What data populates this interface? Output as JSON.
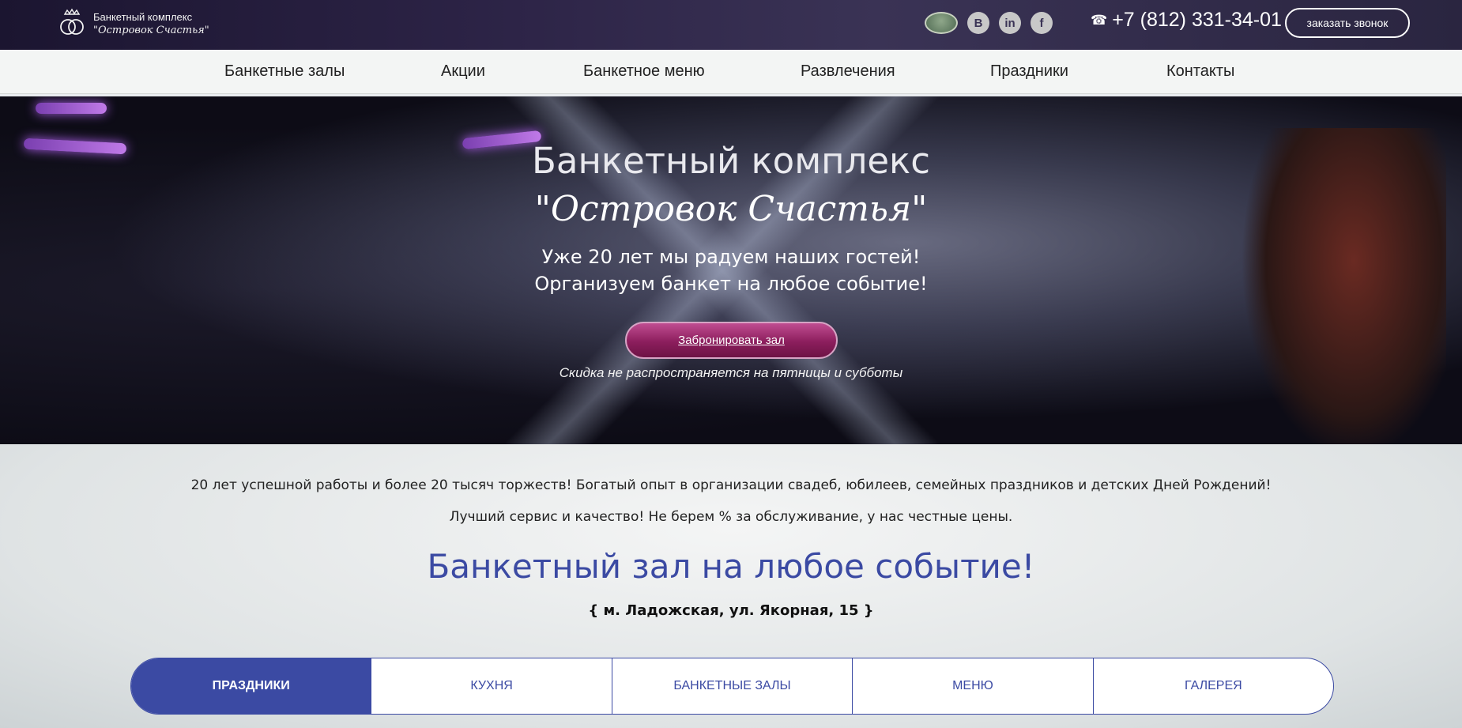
{
  "logo": {
    "line1": "Банкетный комплекс",
    "line2": "\"Островок Счастья\""
  },
  "header": {
    "socials": [
      {
        "icon": "vk-icon",
        "glyph": "B"
      },
      {
        "icon": "linkedin-icon",
        "glyph": "in"
      },
      {
        "icon": "facebook-icon",
        "glyph": "f"
      }
    ],
    "phone": "+7 (812) 331-34-01",
    "callback_label": "заказать звонок"
  },
  "nav": {
    "items": [
      {
        "label": "Банкетные залы"
      },
      {
        "label": "Акции"
      },
      {
        "label": "Банкетное меню"
      },
      {
        "label": "Развлечения"
      },
      {
        "label": "Праздники"
      },
      {
        "label": "Контакты"
      }
    ]
  },
  "hero": {
    "title": "Банкетный комплекс",
    "script_title": "\"Островок Счастья\"",
    "subtitle_line1": "Уже 20 лет мы радуем наших гостей!",
    "subtitle_line2": "Организуем банкет на любое событие!",
    "button_label": "Забронировать зал",
    "note": "Скидка не распространяется на пятницы и субботы"
  },
  "main": {
    "intro_line1": "20 лет успешной работы и более 20 тысяч торжеств! Богатый опыт в организации свадеб, юбилеев, семейных праздников и детских Дней Рождений!",
    "intro_line2": "Лучший сервис и качество! Не берем % за обслуживание, у нас честные цены.",
    "section_title": "Банкетный зал на любое событие!",
    "address": "{ м. Ладожская, ул. Якорная, 15 }",
    "tabs": [
      {
        "label": "ПРАЗДНИКИ",
        "active": true
      },
      {
        "label": "КУХНЯ",
        "active": false
      },
      {
        "label": "БАНКЕТНЫЕ ЗАЛЫ",
        "active": false
      },
      {
        "label": "МЕНЮ",
        "active": false
      },
      {
        "label": "ГАЛЕРЕЯ",
        "active": false
      }
    ]
  },
  "colors": {
    "accent_blue": "#3b4aa3",
    "button_magenta": "#8c1e5d",
    "topbar_dark": "#2d2447"
  }
}
